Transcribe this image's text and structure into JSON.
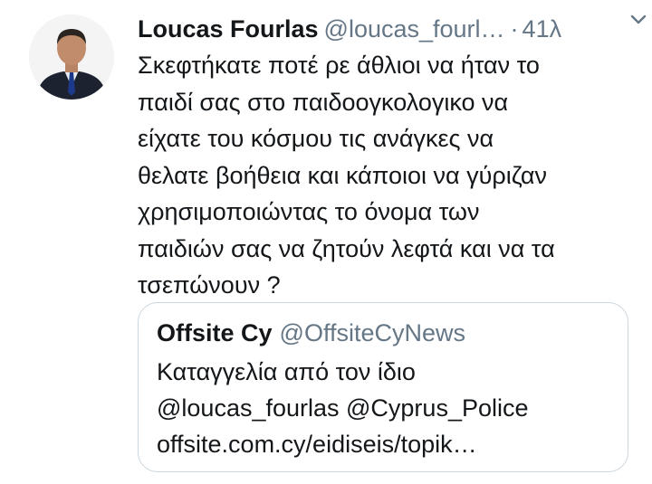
{
  "tweet": {
    "author_name": "Loucas Fourlas",
    "author_handle": "@loucas_fourl…",
    "separator": "·",
    "timestamp": "41λ",
    "text": "Σκεφτήκατε ποτέ ρε άθλιοι να ήταν το\nπαιδί σας στο παιδοογκολογικο να\nείχατε του κόσμου τις ανάγκες να\nθελατε βοήθεια και κάποιοι να γύριζαν\nχρησιμοποιώντας το όνομα των\nπαιδιών σας να ζητούν λεφτά και  να τα\nτσεπώνουν ?"
  },
  "quote": {
    "author_name": "Offsite Cy",
    "author_handle": "@OffsiteCyNews",
    "lines": [
      "Καταγγελία από τον ίδιο",
      "@loucas_fourlas @Cyprus_Police",
      "offsite.com.cy/eidiseis/topik…"
    ]
  },
  "icons": {
    "avatar": "profile-photo",
    "caret": "chevron-down-icon"
  },
  "colors": {
    "text": "#14171a",
    "secondary": "#657786",
    "border": "#ccd6dd",
    "background": "#ffffff"
  }
}
